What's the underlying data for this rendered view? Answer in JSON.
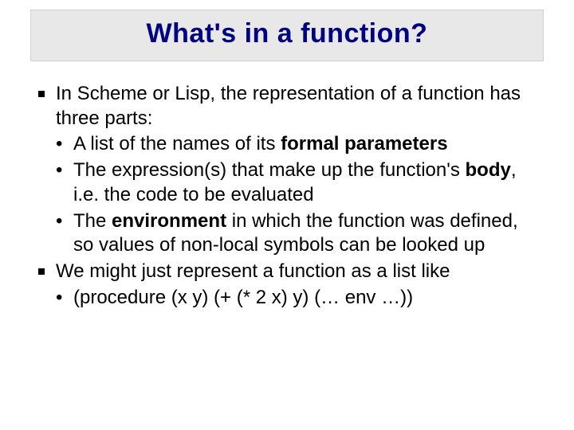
{
  "title": "What's in a function?",
  "bullets": {
    "b1_pre": "In Scheme or Lisp, the representation of a function has three parts:",
    "b1a_pre": "A list of the names of its ",
    "b1a_bold": "formal parameters",
    "b1b_pre": "The expression(s) that make up the function's ",
    "b1b_bold": "body",
    "b1b_post": ", i.e. the code to be evaluated",
    "b1c_pre": "The ",
    "b1c_bold": "environment",
    "b1c_post": " in which the function was defined, so values of non-local symbols can be looked up",
    "b2": "We might just represent a function as a list like",
    "b2a": "(procedure  (x y)  (+ (* 2 x) y)  (… env …))"
  }
}
